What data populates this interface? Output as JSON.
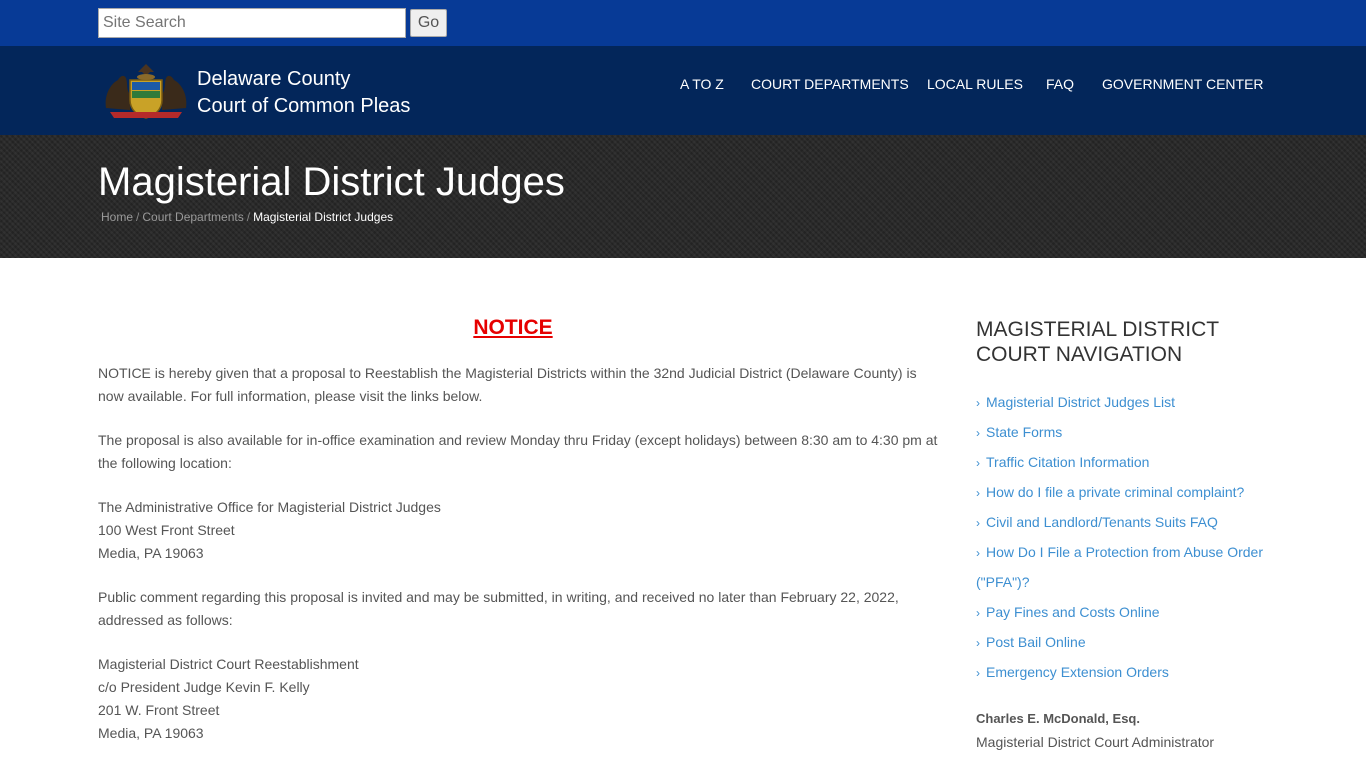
{
  "search": {
    "placeholder": "Site Search",
    "button": "Go"
  },
  "header": {
    "title_line1": "Delaware County",
    "title_line2": "Court of Common Pleas",
    "nav": [
      "A TO Z",
      "COURT DEPARTMENTS",
      "LOCAL RULES",
      "FAQ",
      "GOVERNMENT CENTER"
    ]
  },
  "banner": {
    "title": "Magisterial District Judges",
    "breadcrumb": [
      "Home",
      "Court Departments",
      "Magisterial District Judges"
    ]
  },
  "main": {
    "heading": "NOTICE",
    "p1": "NOTICE is hereby given that a proposal to Reestablish the Magisterial Districts within the 32nd Judicial District (Delaware County) is now available. For full information, please visit the links below.",
    "p2": "The proposal is also available for in-office examination and review Monday thru Friday (except holidays) between 8:30 am to 4:30 pm at the following location:",
    "address1": [
      "The Administrative Office for Magisterial District Judges",
      "100 West Front Street",
      "Media, PA 19063"
    ],
    "p3": "Public comment regarding this proposal is invited and may be submitted, in writing, and received no later than February 22, 2022, addressed as follows:",
    "address2": [
      "Magisterial District Court Reestablishment",
      "c/o President Judge Kevin F. Kelly",
      "201 W. Front Street",
      "Media, PA 19063"
    ]
  },
  "sidebar": {
    "title": "MAGISTERIAL DISTRICT COURT NAVIGATION",
    "links": [
      "Magisterial District Judges List",
      "State Forms",
      "Traffic Citation Information",
      "How do I file a private criminal complaint?",
      "Civil and Landlord/Tenants Suits FAQ",
      "How Do I File a Protection from Abuse Order",
      "(\"PFA\")?",
      "Pay Fines and Costs Online",
      "Post Bail Online",
      "Emergency Extension Orders"
    ],
    "admin_name": "Charles E. McDonald, Esq.",
    "admin_title": "Magisterial District Court Administrator"
  },
  "colors": {
    "topbar": "#073a96",
    "header": "#03265a",
    "notice": "#e60000",
    "link": "#3d8fd1"
  }
}
